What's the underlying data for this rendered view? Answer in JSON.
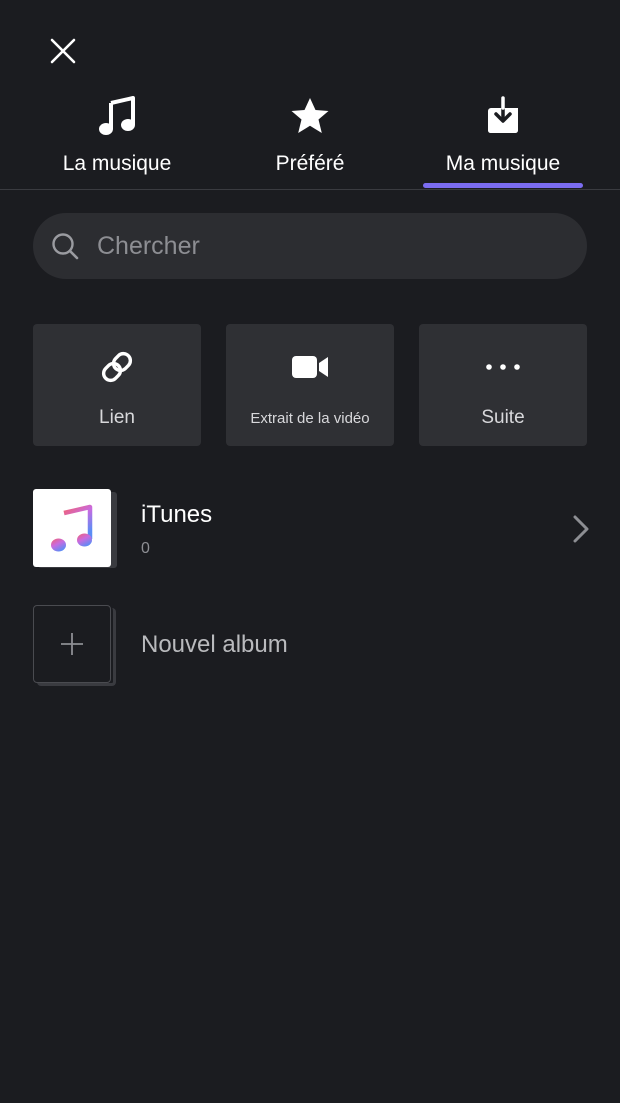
{
  "header": {
    "close_icon": "close-icon"
  },
  "tabs": [
    {
      "label": "La musique",
      "icon": "music-note-icon",
      "active": false
    },
    {
      "label": "Préféré",
      "icon": "star-icon",
      "active": false
    },
    {
      "label": "Ma musique",
      "icon": "download-icon",
      "active": true
    }
  ],
  "colors": {
    "accent": "#7b6cf0",
    "background": "#1b1c20",
    "card": "#2f3034"
  },
  "search": {
    "placeholder": "Chercher",
    "value": "",
    "icon": "search-icon"
  },
  "actions": [
    {
      "label": "Lien",
      "icon": "link-icon"
    },
    {
      "label": "Extrait de la vidéo",
      "icon": "video-camera-icon"
    },
    {
      "label": "Suite",
      "icon": "more-icon"
    }
  ],
  "albums": [
    {
      "title": "iTunes",
      "count": "0",
      "icon": "itunes-music-icon"
    }
  ],
  "new_album": {
    "label": "Nouvel album",
    "icon": "plus-icon"
  }
}
